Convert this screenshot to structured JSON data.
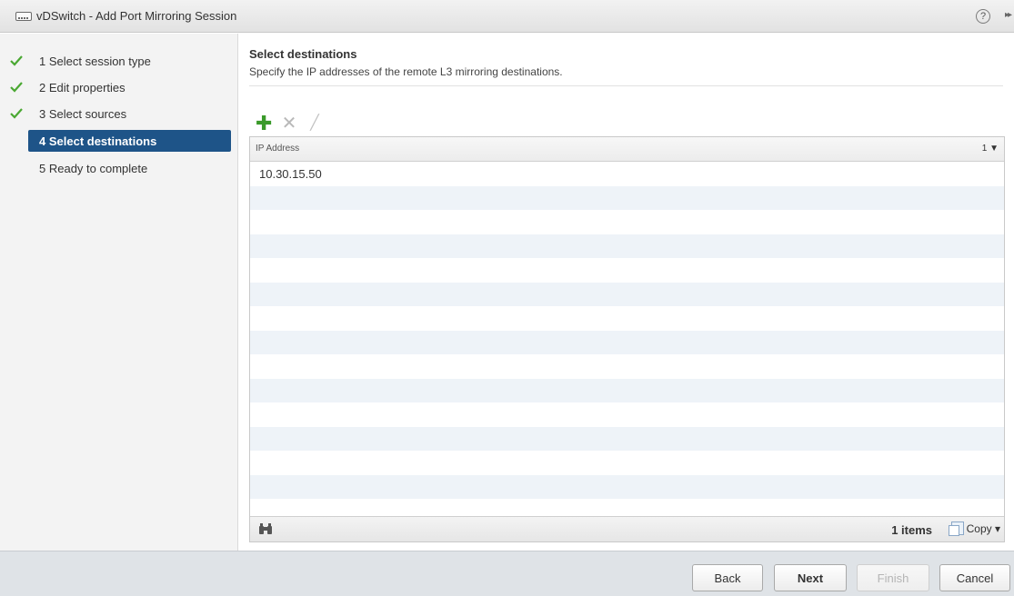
{
  "window": {
    "title": "vDSwitch - Add Port Mirroring Session",
    "help_label": "?",
    "expand_label": "▸▸"
  },
  "steps": [
    {
      "label": "1  Select session type",
      "completed": true
    },
    {
      "label": "2  Edit properties",
      "completed": true
    },
    {
      "label": "3  Select sources",
      "completed": true
    },
    {
      "label": "4  Select destinations",
      "active": true
    },
    {
      "label": "5  Ready to complete"
    }
  ],
  "main": {
    "heading": "Select destinations",
    "subheading": "Specify the IP addresses of the remote L3 mirroring destinations."
  },
  "toolbar": {
    "add_icon": "add-icon",
    "remove_icon": "remove-icon",
    "edit_icon": "edit-icon"
  },
  "grid": {
    "column_header": "IP Address",
    "sort_indicator": "1 ▼",
    "rows": [
      "10.30.15.50",
      "",
      "",
      "",
      "",
      "",
      "",
      "",
      "",
      "",
      "",
      "",
      "",
      "",
      ""
    ],
    "item_count": "1 items",
    "copy_label": "Copy ▾"
  },
  "buttons": {
    "back": "Back",
    "next": "Next",
    "finish": "Finish",
    "cancel": "Cancel"
  },
  "colors": {
    "active_step": "#1e5488",
    "check": "#4aa832",
    "add": "#3a9a2a",
    "row_alt": "#eef3f8"
  }
}
